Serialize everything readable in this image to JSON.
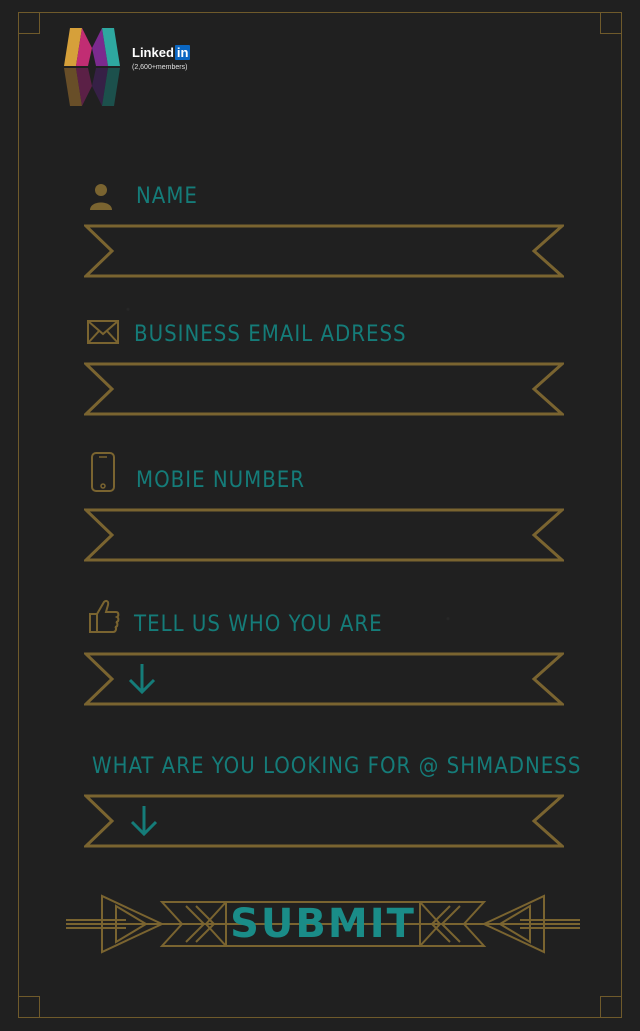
{
  "brand": {
    "linkedin_text": "Linked",
    "linkedin_in": "in",
    "members": "(2,600+members)"
  },
  "form": {
    "fields": [
      {
        "label": "NAME",
        "icon": "person-icon"
      },
      {
        "label": "BUSINESS EMAIL ADRESS",
        "icon": "envelope-icon"
      },
      {
        "label": "MOBIE NUMBER",
        "icon": "phone-icon"
      },
      {
        "label": "TELL US WHO YOU ARE",
        "icon": "thumbs-up-icon"
      },
      {
        "label": "WHAT ARE YOU LOOKING FOR @ SHMADNESS",
        "icon": null
      }
    ],
    "submit_label": "SUBMIT"
  },
  "colors": {
    "background": "#202020",
    "gold": "#7a6430",
    "teal": "#157c79"
  }
}
